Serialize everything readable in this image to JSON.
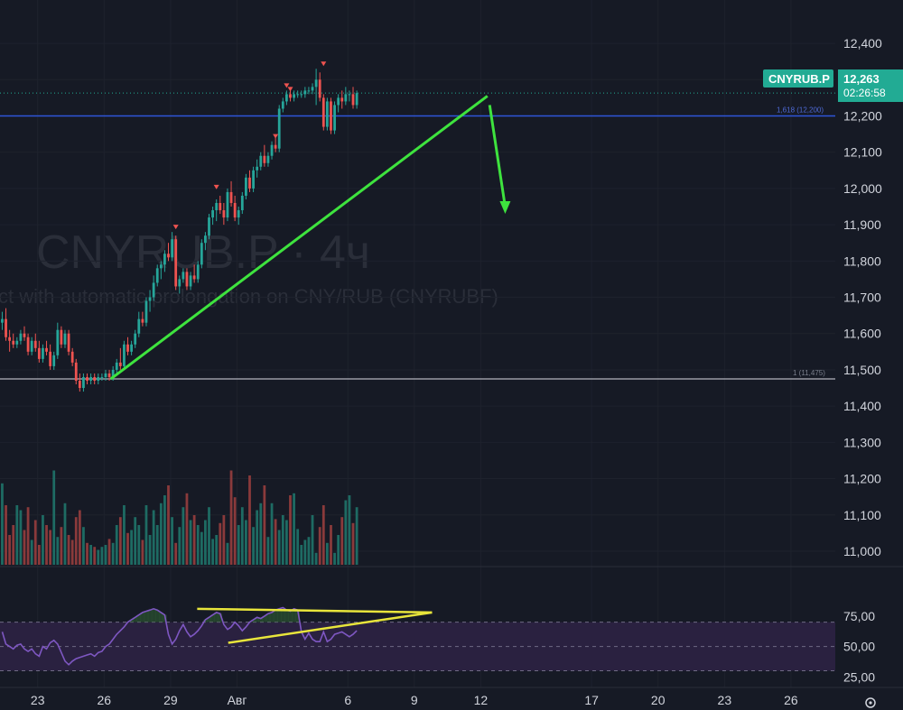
{
  "chart_data": [
    {
      "type": "candlestick",
      "title": "CNYRUB.P · 4ч",
      "subtitle": "ct with automatic prolongation on CNY/RUB (CNYRUBF)",
      "symbol_badge": "CNYRUB.P",
      "last_price": "12,263",
      "countdown": "02:26:58",
      "y_ticks": [
        "12,400",
        "12,300",
        "12,200",
        "12,100",
        "12,000",
        "11,900",
        "11,800",
        "11,700",
        "11,600",
        "11,500",
        "11,400",
        "11,300",
        "11,200",
        "11,100",
        "11,000"
      ],
      "y_tick_values": [
        12.4,
        12.3,
        12.2,
        12.1,
        12.0,
        11.9,
        11.8,
        11.7,
        11.6,
        11.5,
        11.4,
        11.3,
        11.2,
        11.1,
        11.0
      ],
      "ylim": [
        10.98,
        12.45
      ],
      "x_labels": [
        "23",
        "26",
        "29",
        "Авг",
        "6",
        "9",
        "12",
        "17",
        "20",
        "23",
        "26"
      ],
      "x_label_days": [
        23,
        26,
        29,
        32,
        37,
        40,
        43,
        48,
        51,
        54,
        57
      ],
      "xlim_days": [
        21.3,
        59.0
      ],
      "levels": [
        {
          "label": "1,618 (12,200)",
          "value": 12.2,
          "color": "#2e55d8"
        },
        {
          "label": "1 (11,475)",
          "value": 11.475,
          "color": "#b2b5be"
        }
      ],
      "trendline": {
        "start": [
          26.3,
          11.475
        ],
        "end": [
          43.3,
          12.255
        ],
        "color": "#3ee33e"
      },
      "arrow": {
        "start": [
          43.4,
          12.23
        ],
        "end": [
          44.1,
          11.93
        ],
        "color": "#3ee33e"
      },
      "candles": {
        "start_day": 21.4,
        "step_days": 0.1667,
        "ohlc": [
          [
            11.63,
            11.66,
            11.61,
            11.64
          ],
          [
            11.64,
            11.67,
            11.58,
            11.59
          ],
          [
            11.59,
            11.61,
            11.55,
            11.58
          ],
          [
            11.58,
            11.6,
            11.56,
            11.57
          ],
          [
            11.57,
            11.59,
            11.56,
            11.58
          ],
          [
            11.58,
            11.61,
            11.57,
            11.6
          ],
          [
            11.6,
            11.62,
            11.58,
            11.59
          ],
          [
            11.59,
            11.6,
            11.54,
            11.55
          ],
          [
            11.55,
            11.59,
            11.54,
            11.58
          ],
          [
            11.58,
            11.6,
            11.55,
            11.56
          ],
          [
            11.56,
            11.58,
            11.52,
            11.53
          ],
          [
            11.53,
            11.57,
            11.52,
            11.56
          ],
          [
            11.56,
            11.58,
            11.54,
            11.55
          ],
          [
            11.55,
            11.57,
            11.5,
            11.51
          ],
          [
            11.51,
            11.55,
            11.5,
            11.54
          ],
          [
            11.54,
            11.63,
            11.53,
            11.61
          ],
          [
            11.61,
            11.62,
            11.56,
            11.57
          ],
          [
            11.57,
            11.61,
            11.56,
            11.6
          ],
          [
            11.6,
            11.61,
            11.54,
            11.55
          ],
          [
            11.55,
            11.56,
            11.51,
            11.52
          ],
          [
            11.52,
            11.53,
            11.46,
            11.47
          ],
          [
            11.47,
            11.49,
            11.44,
            11.45
          ],
          [
            11.45,
            11.49,
            11.44,
            11.48
          ],
          [
            11.48,
            11.49,
            11.46,
            11.47
          ],
          [
            11.47,
            11.49,
            11.46,
            11.48
          ],
          [
            11.48,
            11.49,
            11.46,
            11.47
          ],
          [
            11.47,
            11.49,
            11.46,
            11.48
          ],
          [
            11.48,
            11.49,
            11.47,
            11.48
          ],
          [
            11.48,
            11.5,
            11.47,
            11.49
          ],
          [
            11.49,
            11.5,
            11.47,
            11.48
          ],
          [
            11.48,
            11.51,
            11.47,
            11.5
          ],
          [
            11.5,
            11.53,
            11.49,
            11.52
          ],
          [
            11.52,
            11.56,
            11.5,
            11.51
          ],
          [
            11.51,
            11.58,
            11.5,
            11.57
          ],
          [
            11.57,
            11.59,
            11.54,
            11.55
          ],
          [
            11.55,
            11.58,
            11.54,
            11.57
          ],
          [
            11.57,
            11.61,
            11.56,
            11.6
          ],
          [
            11.6,
            11.66,
            11.59,
            11.64
          ],
          [
            11.64,
            11.66,
            11.62,
            11.63
          ],
          [
            11.63,
            11.7,
            11.62,
            11.69
          ],
          [
            11.69,
            11.72,
            11.66,
            11.7
          ],
          [
            11.7,
            11.76,
            11.69,
            11.74
          ],
          [
            11.74,
            11.79,
            11.73,
            11.78
          ],
          [
            11.78,
            11.8,
            11.75,
            11.79
          ],
          [
            11.79,
            11.83,
            11.77,
            11.82
          ],
          [
            11.82,
            11.85,
            11.8,
            11.81
          ],
          [
            11.81,
            11.88,
            11.8,
            11.86
          ],
          [
            11.86,
            11.87,
            11.72,
            11.73
          ],
          [
            11.73,
            11.76,
            11.71,
            11.75
          ],
          [
            11.75,
            11.78,
            11.74,
            11.77
          ],
          [
            11.77,
            11.78,
            11.72,
            11.73
          ],
          [
            11.73,
            11.77,
            11.72,
            11.76
          ],
          [
            11.76,
            11.79,
            11.74,
            11.75
          ],
          [
            11.75,
            11.8,
            11.74,
            11.79
          ],
          [
            11.79,
            11.86,
            11.78,
            11.85
          ],
          [
            11.85,
            11.88,
            11.83,
            11.87
          ],
          [
            11.87,
            11.93,
            11.86,
            11.92
          ],
          [
            11.92,
            11.95,
            11.9,
            11.94
          ],
          [
            11.94,
            11.97,
            11.91,
            11.96
          ],
          [
            11.96,
            11.98,
            11.93,
            11.94
          ],
          [
            11.94,
            11.96,
            11.9,
            11.92
          ],
          [
            11.92,
            12.0,
            11.91,
            11.99
          ],
          [
            11.99,
            12.02,
            11.95,
            11.96
          ],
          [
            11.96,
            11.98,
            11.91,
            11.92
          ],
          [
            11.92,
            11.95,
            11.9,
            11.94
          ],
          [
            11.94,
            11.99,
            11.93,
            11.98
          ],
          [
            11.98,
            12.04,
            11.97,
            12.03
          ],
          [
            12.03,
            12.05,
            11.99,
            12.0
          ],
          [
            12.0,
            12.06,
            11.99,
            12.05
          ],
          [
            12.05,
            12.08,
            12.03,
            12.06
          ],
          [
            12.06,
            12.1,
            12.05,
            12.09
          ],
          [
            12.09,
            12.12,
            12.06,
            12.07
          ],
          [
            12.07,
            12.1,
            12.06,
            12.09
          ],
          [
            12.09,
            12.13,
            12.08,
            12.12
          ],
          [
            12.12,
            12.14,
            12.1,
            12.11
          ],
          [
            12.11,
            12.23,
            12.1,
            12.22
          ],
          [
            12.22,
            12.25,
            12.21,
            12.24
          ],
          [
            12.24,
            12.27,
            12.23,
            12.26
          ],
          [
            12.26,
            12.28,
            12.24,
            12.25
          ],
          [
            12.25,
            12.27,
            12.24,
            12.26
          ],
          [
            12.26,
            12.27,
            12.25,
            12.26
          ],
          [
            12.26,
            12.27,
            12.25,
            12.26
          ],
          [
            12.26,
            12.28,
            12.25,
            12.27
          ],
          [
            12.27,
            12.28,
            12.26,
            12.27
          ],
          [
            12.27,
            12.29,
            12.26,
            12.28
          ],
          [
            12.28,
            12.33,
            12.23,
            12.3
          ],
          [
            12.3,
            12.32,
            12.24,
            12.25
          ],
          [
            12.25,
            12.26,
            12.16,
            12.17
          ],
          [
            12.17,
            12.25,
            12.16,
            12.24
          ],
          [
            12.24,
            12.25,
            12.15,
            12.16
          ],
          [
            12.16,
            12.24,
            12.15,
            12.23
          ],
          [
            12.23,
            12.26,
            12.21,
            12.25
          ],
          [
            12.25,
            12.27,
            12.22,
            12.24
          ],
          [
            12.24,
            12.28,
            12.23,
            12.26
          ],
          [
            12.26,
            12.27,
            12.24,
            12.26
          ],
          [
            12.26,
            12.28,
            12.22,
            12.23
          ],
          [
            12.23,
            12.27,
            12.22,
            12.263
          ]
        ]
      },
      "up_color": "#26a69a",
      "down_color": "#ef5350"
    },
    {
      "type": "bar",
      "title": "",
      "series": [
        {
          "name": "",
          "values": [
            82,
            60,
            30,
            40,
            60,
            55,
            35,
            58,
            25,
            45,
            20,
            50,
            40,
            35,
            95,
            28,
            38,
            62,
            30,
            25,
            48,
            55,
            38,
            22,
            20,
            18,
            15,
            18,
            20,
            26,
            22,
            40,
            48,
            60,
            32,
            35,
            48,
            40,
            25,
            60,
            30,
            55,
            40,
            62,
            70,
            80,
            48,
            22,
            38,
            58,
            72,
            45,
            50,
            40,
            33,
            45,
            58,
            26,
            30,
            42,
            50,
            22,
            95,
            68,
            40,
            58,
            45,
            90,
            38,
            55,
            62,
            80,
            28,
            62,
            46,
            35,
            50,
            45,
            70,
            72,
            36,
            20,
            25,
            28,
            50,
            12,
            38,
            60,
            22,
            40,
            12,
            30,
            48,
            65,
            70,
            42,
            58
          ]
        }
      ],
      "ylim": [
        0,
        100
      ]
    },
    {
      "type": "line",
      "title": "",
      "y_ticks": [
        "75,00",
        "50,00",
        "25,00"
      ],
      "y_tick_values": [
        75,
        50,
        25
      ],
      "ylim": [
        20,
        92
      ],
      "band": [
        30,
        70
      ],
      "line_color": "#7e57c2",
      "series": [
        {
          "name": "",
          "values": [
            62,
            52,
            50,
            48,
            51,
            52,
            48,
            46,
            48,
            44,
            42,
            50,
            48,
            53,
            55,
            52,
            45,
            38,
            35,
            38,
            40,
            41,
            42,
            43,
            44,
            42,
            45,
            46,
            50,
            52,
            56,
            60,
            63,
            66,
            70,
            72,
            74,
            76,
            78,
            79,
            80,
            81,
            80,
            78,
            76,
            60,
            52,
            56,
            63,
            68,
            62,
            58,
            60,
            63,
            67,
            72,
            74,
            76,
            78,
            77,
            68,
            64,
            66,
            70,
            67,
            63,
            66,
            70,
            72,
            74,
            73,
            75,
            77,
            78,
            80,
            81,
            82,
            80,
            79,
            81,
            80,
            62,
            56,
            61,
            56,
            54,
            54,
            62,
            54,
            56,
            60,
            61,
            62,
            60,
            58,
            60,
            63
          ]
        }
      ],
      "trendlines": [
        {
          "start": [
            30.2,
            81
          ],
          "end": [
            40.8,
            78
          ],
          "color": "#e8e53b"
        },
        {
          "start": [
            31.6,
            53
          ],
          "end": [
            40.8,
            78
          ],
          "color": "#e8e53b"
        }
      ]
    }
  ],
  "footer": {
    "settings_icon": "gear-icon"
  }
}
